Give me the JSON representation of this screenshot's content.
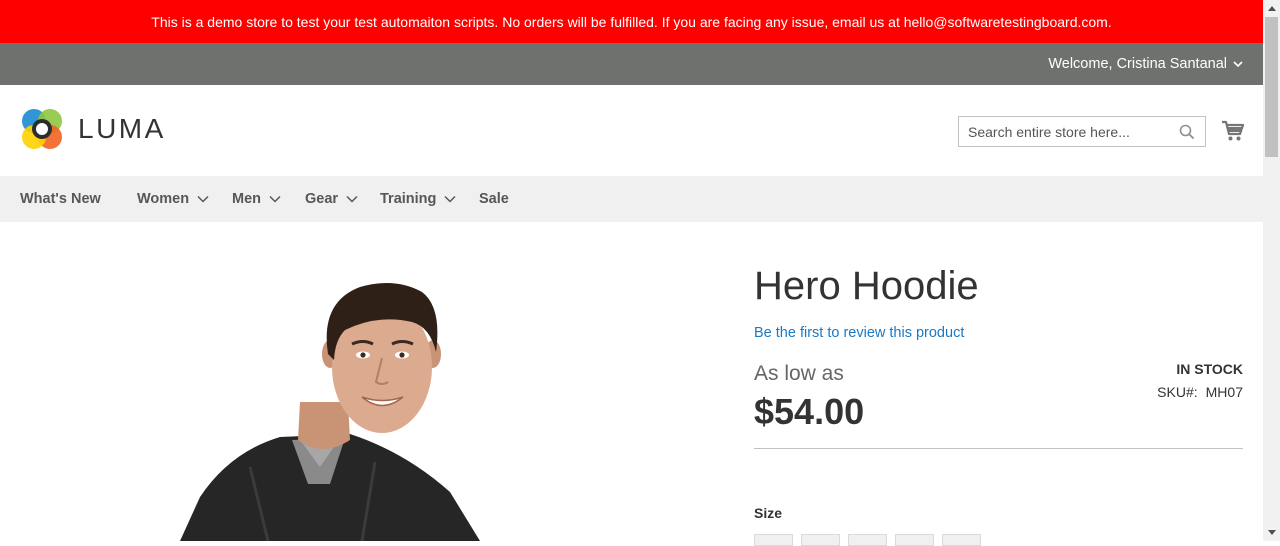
{
  "demo_notice": "This is a demo store to test your test automaiton scripts. No orders will be fulfilled. If you are facing any issue, email us at hello@softwaretestingboard.com.",
  "header_panel": {
    "welcome": "Welcome, Cristina Santanal"
  },
  "logo": {
    "text": "LUMA"
  },
  "search": {
    "placeholder": "Search entire store here..."
  },
  "nav": {
    "items": [
      {
        "label": "What's New",
        "has_dropdown": false
      },
      {
        "label": "Women",
        "has_dropdown": true
      },
      {
        "label": "Men",
        "has_dropdown": true
      },
      {
        "label": "Gear",
        "has_dropdown": true
      },
      {
        "label": "Training",
        "has_dropdown": true
      },
      {
        "label": "Sale",
        "has_dropdown": false
      }
    ]
  },
  "product": {
    "title": "Hero Hoodie",
    "review_link": "Be the first to review this product",
    "price_prefix": "As low as",
    "price": "$54.00",
    "stock": "IN STOCK",
    "sku_label": "SKU#:",
    "sku": "MH07",
    "size_label": "Size"
  },
  "colors": {
    "demo_bar": "#ff0000",
    "panel_header": "#6e716e",
    "nav_bg": "#f0f0f0",
    "link": "#1979c3"
  }
}
